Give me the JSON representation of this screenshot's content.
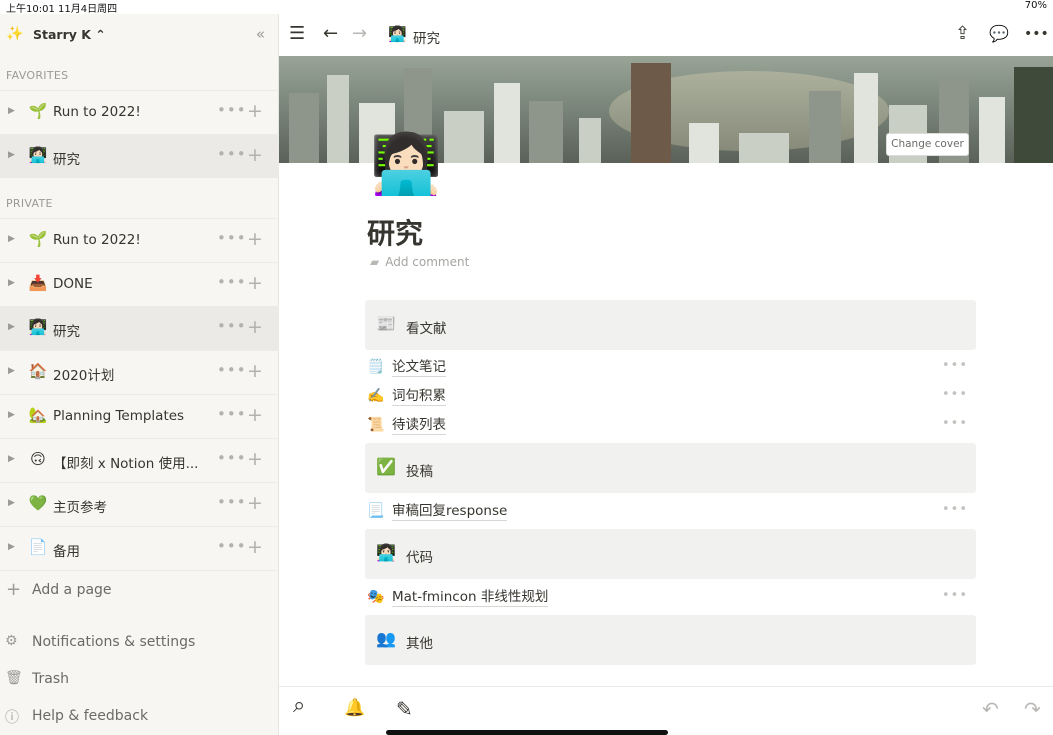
{
  "status": {
    "time": "上午10:01   11月4日周四",
    "right": "70%"
  },
  "sidebar": {
    "workspace_icon": "✨",
    "workspace_name": "Starry K ⌃",
    "collapse_icon": "«",
    "favorites_label": "FAVORITES",
    "favorites": [
      {
        "icon": "🌱",
        "label": "Run to 2022!"
      },
      {
        "icon": "👩🏻‍💻",
        "label": "研究"
      }
    ],
    "private_label": "PRIVATE",
    "private": [
      {
        "icon": "🌱",
        "label": "Run to 2022!"
      },
      {
        "icon": "📥",
        "label": "DONE"
      },
      {
        "icon": "👩🏻‍💻",
        "label": "研究"
      },
      {
        "icon": "🏠",
        "label": "2020计划"
      },
      {
        "icon": "🏡",
        "label": "Planning Templates"
      },
      {
        "icon": "🙃",
        "label": "【即刻 x Notion 使用..."
      },
      {
        "icon": "💚",
        "label": "主页参考"
      },
      {
        "icon": "📄",
        "label": "备用"
      }
    ],
    "more_glyph": "•••",
    "plus_glyph": "+",
    "add_page": "Add a page",
    "notifications": "Notifications & settings",
    "trash": "Trash",
    "help": "Help & feedback"
  },
  "topbar": {
    "menu_icon": "☰",
    "back_icon": "←",
    "forward_icon": "→",
    "crumb_icon": "👩🏻‍💻",
    "crumb": "研究",
    "share_icon": "⇪",
    "comment_icon": "💬",
    "more_icon": "•••"
  },
  "page": {
    "change_cover": "Change cover",
    "icon": "👩🏻‍💻",
    "title": "研究",
    "add_comment": "Add comment",
    "callouts": [
      {
        "icon": "📰",
        "label": "看文献"
      },
      {
        "icon": "✅",
        "label": "投稿"
      },
      {
        "icon": "👩🏻‍💻",
        "label": "代码"
      },
      {
        "icon": "👥",
        "label": "其他"
      }
    ],
    "links_group1": [
      {
        "icon": "🗒️",
        "label": "论文笔记"
      },
      {
        "icon": "✍️",
        "label": "词句积累"
      },
      {
        "icon": "📜",
        "label": "待读列表"
      }
    ],
    "links_group2": [
      {
        "icon": "📃",
        "label": "审稿回复response"
      }
    ],
    "links_group3": [
      {
        "icon": "🎭",
        "label": "Mat-fmincon 非线性规划"
      }
    ],
    "dots": "•••"
  },
  "bottombar": {
    "search_icon": "⌕",
    "bell_icon": "🔔",
    "edit_icon": "✎",
    "undo_icon": "↶",
    "redo_icon": "↷"
  }
}
